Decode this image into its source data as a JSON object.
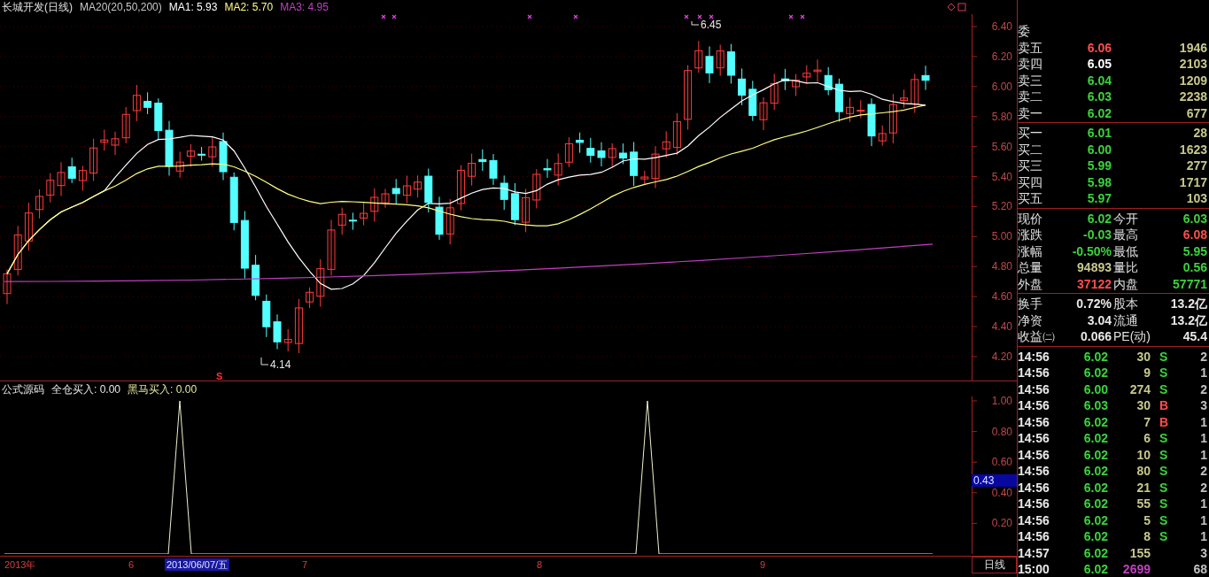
{
  "header": {
    "title": "长城开发(日线)",
    "indicator": "MA20(20,50,200)",
    "ma": [
      {
        "label": "MA1: 5.93",
        "color": "#ffffff"
      },
      {
        "label": "MA2: 5.70",
        "color": "#ffff80"
      },
      {
        "label": "MA3: 4.95",
        "color": "#c040c0"
      }
    ]
  },
  "main_chart": {
    "price_ticks": [
      "6.40",
      "6.20",
      "6.00",
      "5.80",
      "5.60",
      "5.40",
      "5.20",
      "5.00",
      "4.80",
      "4.60",
      "4.40",
      "4.20"
    ],
    "high_label": "6.45",
    "low_label": "4.14",
    "signal": "S"
  },
  "lower_panel": {
    "title": "公式源码",
    "series": [
      {
        "label": "全仓买入: 0.00",
        "color": "#e8e8e8"
      },
      {
        "label": "黑马买入: 0.00",
        "color": "#e8e8a0"
      }
    ],
    "ticks": [
      "1.00",
      "0.80",
      "0.60",
      "0.40",
      "0.20"
    ],
    "cursor_value": "0.43"
  },
  "time_axis": {
    "labels": [
      {
        "text": "2013年",
        "selected": false
      },
      {
        "text": "6",
        "selected": false
      },
      {
        "text": "2013/06/07/五",
        "selected": true
      },
      {
        "text": "7",
        "selected": false
      },
      {
        "text": "8",
        "selected": false
      },
      {
        "text": "9",
        "selected": false
      }
    ],
    "period": "日线"
  },
  "quote_panel": {
    "ratio_label": "委",
    "asks": [
      {
        "label": "卖五",
        "price": "6.06",
        "volume": "1946",
        "color": "#ff4c4c"
      },
      {
        "label": "卖四",
        "price": "6.05",
        "volume": "2103",
        "color": "#ffffff"
      },
      {
        "label": "卖三",
        "price": "6.04",
        "volume": "1209",
        "color": "#3cd23c"
      },
      {
        "label": "卖二",
        "price": "6.03",
        "volume": "2238",
        "color": "#3cd23c"
      },
      {
        "label": "卖一",
        "price": "6.02",
        "volume": "677",
        "color": "#3cd23c"
      }
    ],
    "bids": [
      {
        "label": "买一",
        "price": "6.01",
        "volume": "28",
        "color": "#3cd23c"
      },
      {
        "label": "买二",
        "price": "6.00",
        "volume": "1623",
        "color": "#3cd23c"
      },
      {
        "label": "买三",
        "price": "5.99",
        "volume": "277",
        "color": "#3cd23c"
      },
      {
        "label": "买四",
        "price": "5.98",
        "volume": "1717",
        "color": "#3cd23c"
      },
      {
        "label": "买五",
        "price": "5.97",
        "volume": "103",
        "color": "#3cd23c"
      }
    ],
    "stats": [
      {
        "cells": [
          {
            "label": "现价",
            "value": "6.02",
            "color": "#3cd23c"
          },
          {
            "label": "今开",
            "value": "6.03",
            "color": "#3cd23c"
          }
        ]
      },
      {
        "cells": [
          {
            "label": "涨跌",
            "value": "-0.03",
            "color": "#3cd23c"
          },
          {
            "label": "最高",
            "value": "6.08",
            "color": "#ff4c4c"
          }
        ]
      },
      {
        "cells": [
          {
            "label": "涨幅",
            "value": "-0.50%",
            "color": "#3cd23c"
          },
          {
            "label": "最低",
            "value": "5.95",
            "color": "#3cd23c"
          }
        ]
      },
      {
        "cells": [
          {
            "label": "总量",
            "value": "94893",
            "color": "#c8c88c"
          },
          {
            "label": "量比",
            "value": "0.56",
            "color": "#3cd23c"
          }
        ]
      },
      {
        "cells": [
          {
            "label": "外盘",
            "value": "37122",
            "color": "#ff4c4c"
          },
          {
            "label": "内盘",
            "value": "57771",
            "color": "#3cd23c"
          }
        ]
      }
    ],
    "fundamentals": [
      {
        "cells": [
          {
            "label": "换手",
            "value": "0.72%"
          },
          {
            "label": "股本",
            "value": "13.2亿"
          }
        ]
      },
      {
        "cells": [
          {
            "label": "净资",
            "value": "3.04"
          },
          {
            "label": "流通",
            "value": "13.2亿"
          }
        ]
      },
      {
        "cells": [
          {
            "label": "收益㈡",
            "value": "0.066"
          },
          {
            "label": "PE(动)",
            "value": "45.4"
          }
        ]
      }
    ],
    "trades": [
      {
        "time": "14:56",
        "price": "6.02",
        "volume": "30",
        "color": "#c8c88c",
        "side": {
          "text": "S",
          "color": "#3cd23c"
        },
        "count": "2"
      },
      {
        "time": "14:56",
        "price": "6.02",
        "volume": "9",
        "color": "#c8c88c",
        "side": {
          "text": "S",
          "color": "#3cd23c"
        },
        "count": "1"
      },
      {
        "time": "14:56",
        "price": "6.00",
        "volume": "274",
        "color": "#c8c88c",
        "side": {
          "text": "S",
          "color": "#3cd23c"
        },
        "count": "2"
      },
      {
        "time": "14:56",
        "price": "6.03",
        "volume": "30",
        "color": "#c8c88c",
        "side": {
          "text": "B",
          "color": "#ff4c4c"
        },
        "count": "3"
      },
      {
        "time": "14:56",
        "price": "6.02",
        "volume": "7",
        "color": "#c8c88c",
        "side": {
          "text": "B",
          "color": "#ff4c4c"
        },
        "count": "1"
      },
      {
        "time": "14:56",
        "price": "6.02",
        "volume": "6",
        "color": "#c8c88c",
        "side": {
          "text": "S",
          "color": "#3cd23c"
        },
        "count": "1"
      },
      {
        "time": "14:56",
        "price": "6.02",
        "volume": "10",
        "color": "#c8c88c",
        "side": {
          "text": "S",
          "color": "#3cd23c"
        },
        "count": "1"
      },
      {
        "time": "14:56",
        "price": "6.02",
        "volume": "80",
        "color": "#c8c88c",
        "side": {
          "text": "S",
          "color": "#3cd23c"
        },
        "count": "2"
      },
      {
        "time": "14:56",
        "price": "6.02",
        "volume": "21",
        "color": "#c8c88c",
        "side": {
          "text": "S",
          "color": "#3cd23c"
        },
        "count": "2"
      },
      {
        "time": "14:56",
        "price": "6.02",
        "volume": "55",
        "color": "#c8c88c",
        "side": {
          "text": "S",
          "color": "#3cd23c"
        },
        "count": "1"
      },
      {
        "time": "14:56",
        "price": "6.02",
        "volume": "5",
        "color": "#c8c88c",
        "side": {
          "text": "S",
          "color": "#3cd23c"
        },
        "count": "1"
      },
      {
        "time": "14:56",
        "price": "6.02",
        "volume": "8",
        "color": "#c8c88c",
        "side": {
          "text": "S",
          "color": "#3cd23c"
        },
        "count": "1"
      },
      {
        "time": "14:57",
        "price": "6.02",
        "volume": "155",
        "color": "#c8c88c",
        "count": "3"
      },
      {
        "time": "15:00",
        "price": "6.02",
        "volume": "2699",
        "color": "#c040c0",
        "count": "68"
      }
    ]
  }
}
